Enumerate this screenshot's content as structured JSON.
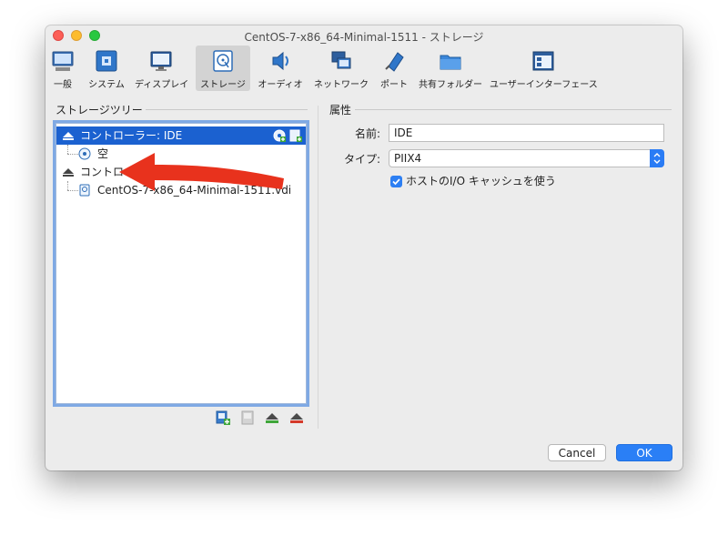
{
  "window": {
    "title": "CentOS-7-x86_64-Minimal-1511 - ストレージ"
  },
  "toolbar": {
    "items": [
      {
        "label": "一般",
        "icon": "general-icon"
      },
      {
        "label": "システム",
        "icon": "system-icon"
      },
      {
        "label": "ディスプレイ",
        "icon": "display-icon"
      },
      {
        "label": "ストレージ",
        "icon": "storage-icon",
        "active": true
      },
      {
        "label": "オーディオ",
        "icon": "audio-icon"
      },
      {
        "label": "ネットワーク",
        "icon": "network-icon"
      },
      {
        "label": "ポート",
        "icon": "port-icon"
      },
      {
        "label": "共有フォルダー",
        "icon": "shared-folder-icon"
      },
      {
        "label": "ユーザーインターフェース",
        "icon": "user-interface-icon"
      }
    ]
  },
  "storage_tree": {
    "title": "ストレージツリー",
    "items": [
      {
        "label": "コントローラー: IDE",
        "selected": true
      },
      {
        "label": "空"
      },
      {
        "label": "コントローラー: SATA"
      },
      {
        "label": "CentOS-7-x86_64-Minimal-1511.vdi"
      }
    ]
  },
  "attributes": {
    "title": "属性",
    "name_label": "名前:",
    "name_value": "IDE",
    "type_label": "タイプ:",
    "type_value": "PIIX4",
    "host_io_cache_label": "ホストのI/O キャッシュを使う",
    "host_io_cache_checked": true
  },
  "footer": {
    "cancel_label": "Cancel",
    "ok_label": "OK"
  },
  "colors": {
    "accent": "#2a7ff6",
    "selection": "#1b61d0",
    "annotation_arrow": "#e8321d"
  }
}
